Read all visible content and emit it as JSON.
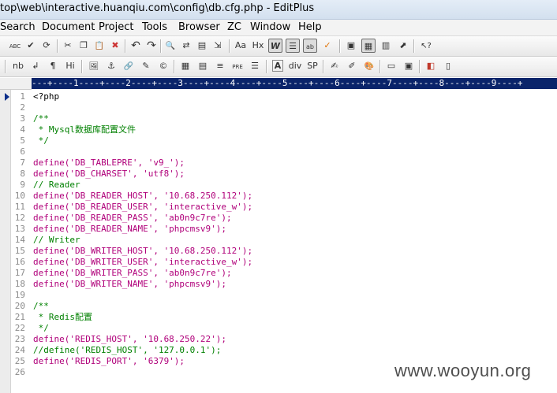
{
  "window": {
    "title": "top\\web\\interactive.huanqiu.com\\config\\db.cfg.php - EditPlus"
  },
  "menu": [
    "Search",
    "Document",
    "Project",
    "Tools",
    "Browser",
    "ZC",
    "Window",
    "Help"
  ],
  "toolbar1": [
    {
      "icon": "spellcheck-icon",
      "glyph": "ABC"
    },
    {
      "icon": "check-icon",
      "glyph": "✔"
    },
    {
      "icon": "refresh-icon",
      "glyph": "⟳"
    },
    {
      "icon": "cut-icon",
      "glyph": "✂"
    },
    {
      "icon": "copy-icon",
      "glyph": "❐"
    },
    {
      "icon": "paste-icon",
      "glyph": "📋"
    },
    {
      "icon": "delete-icon",
      "glyph": "✖"
    },
    {
      "icon": "undo-icon",
      "glyph": "↶"
    },
    {
      "icon": "redo-icon",
      "glyph": "↷"
    },
    {
      "icon": "find-icon",
      "glyph": "🔍"
    },
    {
      "icon": "replace-icon",
      "glyph": "⇄"
    },
    {
      "icon": "find-in-files-icon",
      "glyph": "▤"
    },
    {
      "icon": "goto-icon",
      "glyph": "⇲"
    },
    {
      "icon": "font-size-icon",
      "glyph": "Aa"
    },
    {
      "icon": "hex-icon",
      "glyph": "Hx"
    },
    {
      "icon": "word-wrap-icon",
      "glyph": "W"
    },
    {
      "icon": "column-select-icon",
      "glyph": "☰"
    },
    {
      "icon": "abcd-icon",
      "glyph": "ab"
    },
    {
      "icon": "spell-mark-icon",
      "glyph": "✓"
    },
    {
      "icon": "view-icon",
      "glyph": "▣"
    },
    {
      "icon": "directory-icon",
      "glyph": "▦"
    },
    {
      "icon": "cliptext-icon",
      "glyph": "▥"
    },
    {
      "icon": "output-icon",
      "glyph": "⬈"
    },
    {
      "icon": "help-pointer-icon",
      "glyph": "↖?"
    }
  ],
  "toolbar2": [
    {
      "icon": "nb-icon",
      "glyph": "nb"
    },
    {
      "icon": "line-break-icon",
      "glyph": "↲"
    },
    {
      "icon": "paragraph-icon",
      "glyph": "¶"
    },
    {
      "icon": "heading-icon",
      "glyph": "Hi"
    },
    {
      "icon": "image-icon",
      "glyph": "🖼"
    },
    {
      "icon": "anchor-icon",
      "glyph": "⚓"
    },
    {
      "icon": "link-icon",
      "glyph": "🔗"
    },
    {
      "icon": "edit-tag-icon",
      "glyph": "✎"
    },
    {
      "icon": "copyright-icon",
      "glyph": "©"
    },
    {
      "icon": "table-icon",
      "glyph": "▦"
    },
    {
      "icon": "table-row-icon",
      "glyph": "▤"
    },
    {
      "icon": "horizontal-rule-icon",
      "glyph": "≡"
    },
    {
      "icon": "pre-icon",
      "glyph": "PRE"
    },
    {
      "icon": "list-icon",
      "glyph": "☰"
    },
    {
      "icon": "font-icon",
      "glyph": "A"
    },
    {
      "icon": "div-icon",
      "glyph": "div"
    },
    {
      "icon": "span-icon",
      "glyph": "SP"
    },
    {
      "icon": "form-icon",
      "glyph": "✍"
    },
    {
      "icon": "script-icon",
      "glyph": "✐"
    },
    {
      "icon": "color-icon",
      "glyph": "🎨"
    },
    {
      "icon": "layout-icon",
      "glyph": "▭"
    },
    {
      "icon": "frame-icon",
      "glyph": "▣"
    },
    {
      "icon": "browser-preview-icon",
      "glyph": "◧"
    },
    {
      "icon": "panel-icon",
      "glyph": "▯"
    }
  ],
  "ruler": "---+----1----+----2----+----3----+----4----+----5----+----6----+----7----+----8----+----9----+",
  "code": [
    {
      "n": "1",
      "parts": [
        {
          "t": "<?php",
          "c": "black"
        }
      ]
    },
    {
      "n": "2",
      "parts": []
    },
    {
      "n": "3",
      "parts": [
        {
          "t": "/**",
          "c": "comment"
        }
      ]
    },
    {
      "n": "4",
      "parts": [
        {
          "t": " * Mysql数据库配置文件",
          "c": "comment"
        }
      ]
    },
    {
      "n": "5",
      "parts": [
        {
          "t": " */",
          "c": "comment"
        }
      ]
    },
    {
      "n": "6",
      "parts": []
    },
    {
      "n": "7",
      "parts": [
        {
          "t": "define('DB_TABLEPRE', 'v9_');",
          "c": "func"
        }
      ]
    },
    {
      "n": "8",
      "parts": [
        {
          "t": "define('DB_CHARSET', 'utf8');",
          "c": "func"
        }
      ]
    },
    {
      "n": "9",
      "parts": [
        {
          "t": "// Reader",
          "c": "comment"
        }
      ]
    },
    {
      "n": "10",
      "parts": [
        {
          "t": "define('DB_READER_HOST', '10.68.250.112');",
          "c": "func"
        }
      ]
    },
    {
      "n": "11",
      "parts": [
        {
          "t": "define('DB_READER_USER', 'interactive_w');",
          "c": "func"
        }
      ]
    },
    {
      "n": "12",
      "parts": [
        {
          "t": "define('DB_READER_PASS', 'ab0n9c7re');",
          "c": "func"
        }
      ]
    },
    {
      "n": "13",
      "parts": [
        {
          "t": "define('DB_READER_NAME', 'phpcmsv9');",
          "c": "func"
        }
      ]
    },
    {
      "n": "14",
      "parts": [
        {
          "t": "// Writer",
          "c": "comment"
        }
      ]
    },
    {
      "n": "15",
      "parts": [
        {
          "t": "define('DB_WRITER_HOST', '10.68.250.112');",
          "c": "func"
        }
      ]
    },
    {
      "n": "16",
      "parts": [
        {
          "t": "define('DB_WRITER_USER', 'interactive_w');",
          "c": "func"
        }
      ]
    },
    {
      "n": "17",
      "parts": [
        {
          "t": "define('DB_WRITER_PASS', 'ab0n9c7re');",
          "c": "func"
        }
      ]
    },
    {
      "n": "18",
      "parts": [
        {
          "t": "define('DB_WRITER_NAME', 'phpcmsv9');",
          "c": "func"
        }
      ]
    },
    {
      "n": "19",
      "parts": []
    },
    {
      "n": "20",
      "parts": [
        {
          "t": "/**",
          "c": "comment"
        }
      ]
    },
    {
      "n": "21",
      "parts": [
        {
          "t": " * Redis配置",
          "c": "comment"
        }
      ]
    },
    {
      "n": "22",
      "parts": [
        {
          "t": " */",
          "c": "comment"
        }
      ]
    },
    {
      "n": "23",
      "parts": [
        {
          "t": "define('REDIS_HOST', '10.68.250.22');",
          "c": "func"
        }
      ]
    },
    {
      "n": "24",
      "parts": [
        {
          "t": "//define('REDIS_HOST', '127.0.0.1');",
          "c": "comment"
        }
      ]
    },
    {
      "n": "25",
      "parts": [
        {
          "t": "define('REDIS_PORT', '6379');",
          "c": "func"
        }
      ]
    },
    {
      "n": "26",
      "parts": []
    }
  ],
  "watermark": "www.wooyun.org",
  "colors": {
    "comment": "#008000",
    "func": "#b0007a",
    "ruler": "#0a246a"
  }
}
